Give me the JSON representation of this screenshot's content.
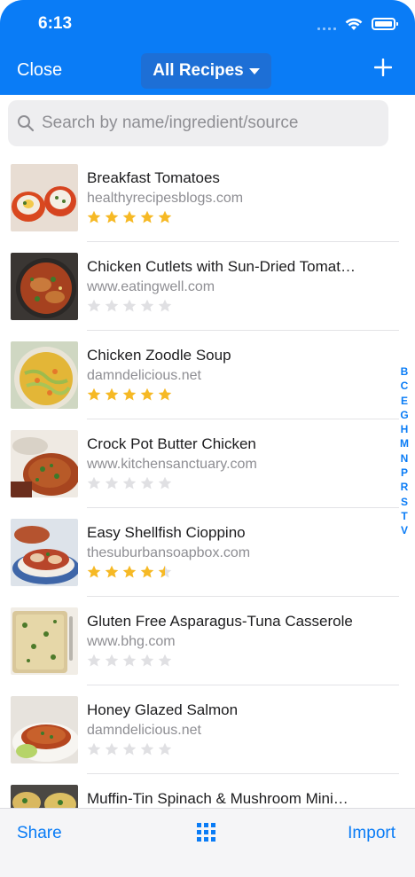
{
  "status_bar": {
    "time": "6:13"
  },
  "nav": {
    "close_label": "Close",
    "title": "All Recipes"
  },
  "search": {
    "placeholder": "Search by name/ingredient/source"
  },
  "recipes": [
    {
      "title": "Breakfast Tomatoes",
      "source": "healthyrecipesblogs.com",
      "rating": 5
    },
    {
      "title": "Chicken Cutlets with Sun-Dried Tomat…",
      "source": "www.eatingwell.com",
      "rating": 0
    },
    {
      "title": "Chicken Zoodle Soup",
      "source": "damndelicious.net",
      "rating": 5
    },
    {
      "title": "Crock Pot Butter Chicken",
      "source": "www.kitchensanctuary.com",
      "rating": 0
    },
    {
      "title": "Easy Shellfish Cioppino",
      "source": "thesuburbansoapbox.com",
      "rating": 4.5
    },
    {
      "title": "Gluten Free Asparagus-Tuna Casserole",
      "source": "www.bhg.com",
      "rating": 0
    },
    {
      "title": "Honey Glazed Salmon",
      "source": "damndelicious.net",
      "rating": 0
    },
    {
      "title": "Muffin-Tin Spinach & Mushroom Mini…",
      "source": "",
      "rating": 0
    }
  ],
  "index_letters": [
    "B",
    "C",
    "E",
    "G",
    "H",
    "M",
    "N",
    "P",
    "R",
    "S",
    "T",
    "V"
  ],
  "toolbar": {
    "share_label": "Share",
    "import_label": "Import"
  },
  "colors": {
    "accent": "#0a7cf6",
    "star_filled": "#f6b925",
    "star_empty": "#e0e0e3"
  }
}
